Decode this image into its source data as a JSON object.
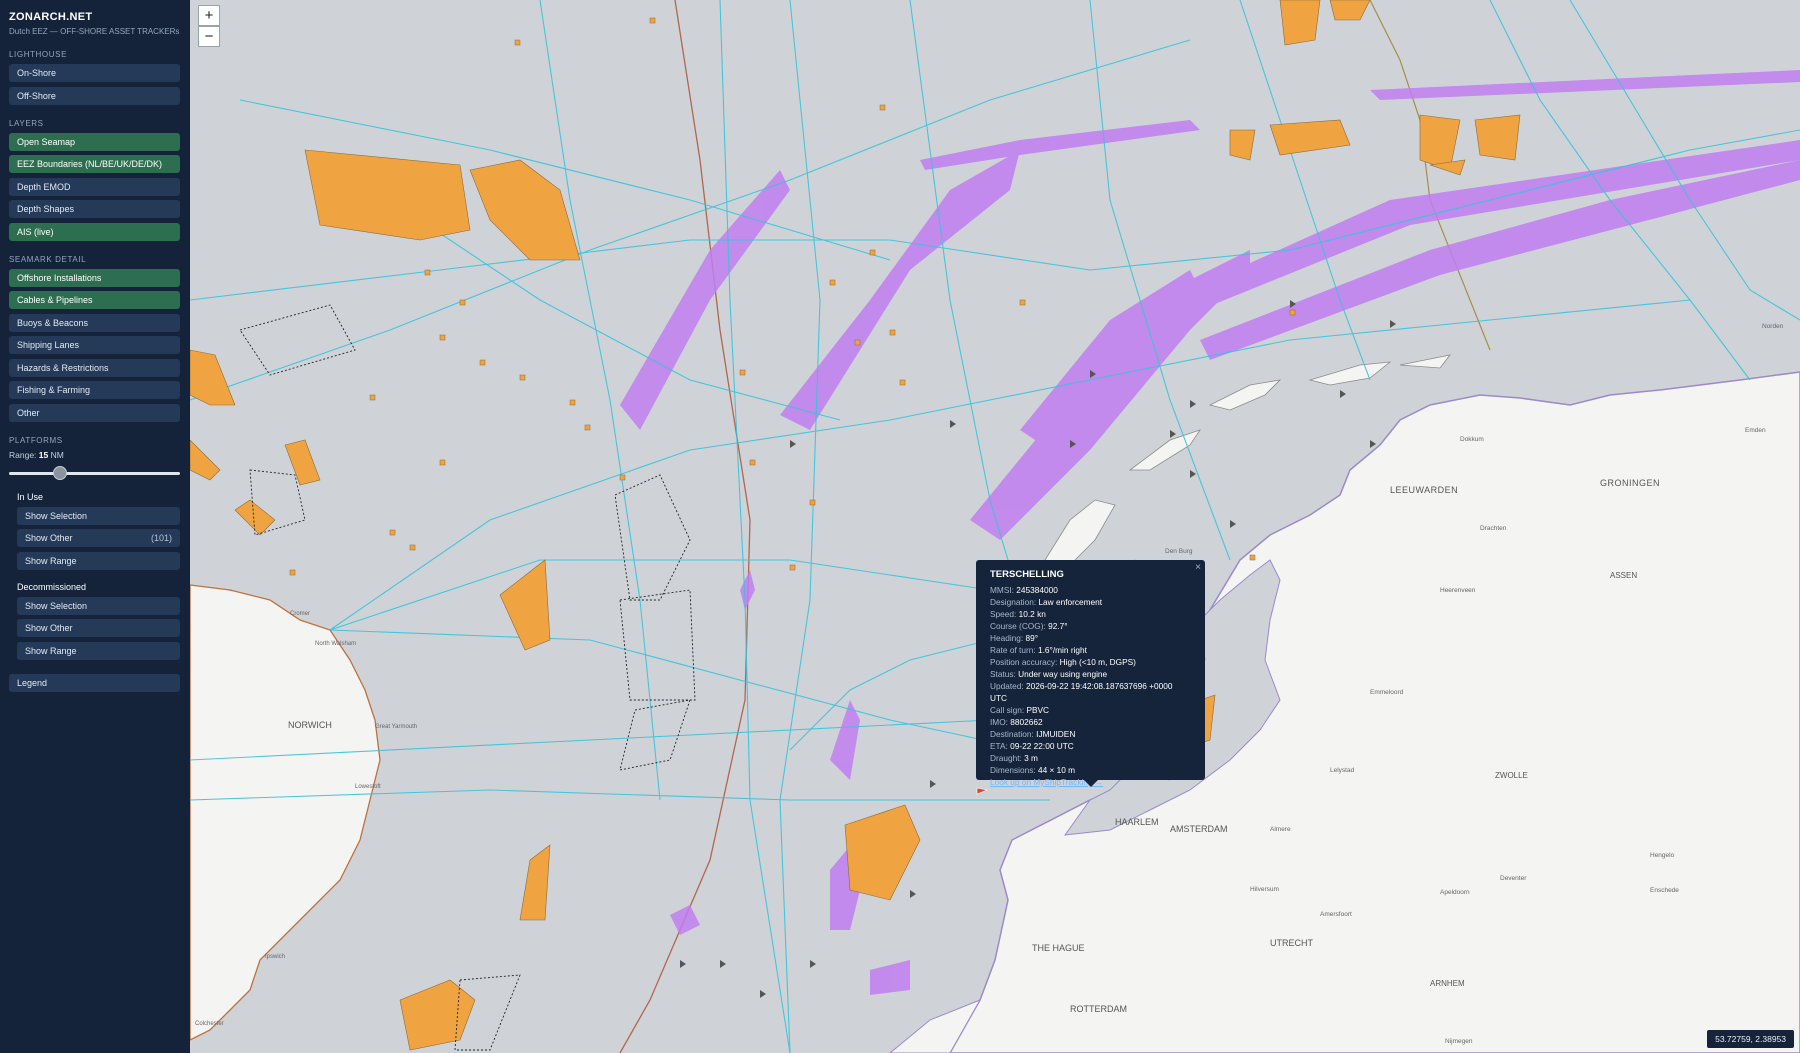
{
  "brand": {
    "title": "ZONARCH.NET",
    "subtitle": "Dutch EEZ — OFF-SHORE ASSET TRACKERs"
  },
  "lighthouse": {
    "heading": "LIGHTHOUSE",
    "items": [
      {
        "label": "On-Shore",
        "active": false
      },
      {
        "label": "Off-Shore",
        "active": false
      }
    ]
  },
  "layers": {
    "heading": "LAYERS",
    "items": [
      {
        "label": "Open Seamap",
        "active": true
      },
      {
        "label": "EEZ Boundaries (NL/BE/UK/DE/DK)",
        "active": true
      },
      {
        "label": "Depth EMOD",
        "active": false
      },
      {
        "label": "Depth Shapes",
        "active": false
      },
      {
        "label": "AIS (live)",
        "active": true
      }
    ]
  },
  "seamark": {
    "heading": "SEAMARK DETAIL",
    "items": [
      {
        "label": "Offshore Installations",
        "active": true
      },
      {
        "label": "Cables & Pipelines",
        "active": true
      },
      {
        "label": "Buoys & Beacons",
        "active": false
      },
      {
        "label": "Shipping Lanes",
        "active": false
      },
      {
        "label": "Hazards & Restrictions",
        "active": false
      },
      {
        "label": "Fishing & Farming",
        "active": false
      },
      {
        "label": "Other",
        "active": false
      }
    ]
  },
  "platforms": {
    "heading": "PLATFORMS",
    "range_label": "Range:",
    "range_value": "15",
    "range_unit": "NM",
    "range_fraction": 0.3,
    "in_use": {
      "heading": "In Use",
      "items": [
        {
          "label": "Show Selection"
        },
        {
          "label": "Show Other",
          "count": "(101)"
        },
        {
          "label": "Show Range"
        }
      ]
    },
    "decommissioned": {
      "heading": "Decommissioned",
      "items": [
        {
          "label": "Show Selection"
        },
        {
          "label": "Show Other"
        },
        {
          "label": "Show Range"
        }
      ]
    }
  },
  "legend_label": "Legend",
  "zoom": {
    "in": "+",
    "out": "−"
  },
  "popup": {
    "title": "TERSCHELLING",
    "close": "×",
    "rows": [
      {
        "k": "MMSI:",
        "v": "245384000"
      },
      {
        "k": "Designation:",
        "v": "Law enforcement"
      },
      {
        "k": "Speed:",
        "v": "10.2 kn"
      },
      {
        "k": "Course (COG):",
        "v": "92.7°"
      },
      {
        "k": "Heading:",
        "v": "89°"
      },
      {
        "k": "Rate of turn:",
        "v": "1.6°/min right"
      },
      {
        "k": "Position accuracy:",
        "v": "High (<10 m, DGPS)"
      },
      {
        "k": "Status:",
        "v": "Under way using engine"
      },
      {
        "k": "Updated:",
        "v": "2026-09-22 19:42:08.187637696 +0000 UTC"
      },
      {
        "k": "Call sign:",
        "v": "PBVC"
      },
      {
        "k": "IMO:",
        "v": "8802662"
      },
      {
        "k": "Destination:",
        "v": "IJMUIDEN"
      },
      {
        "k": "ETA:",
        "v": "09-22 22:00 UTC"
      },
      {
        "k": "Draught:",
        "v": "3 m"
      },
      {
        "k": "Dimensions:",
        "v": "44 × 10 m"
      }
    ],
    "link": "Look up on MyShipTracking →"
  },
  "coords": "53.72759, 2.38953",
  "map_labels": {
    "leeuwarden": "LEEUWARDEN",
    "groningen": "GRONINGEN",
    "assen": "ASSEN",
    "zwolle": "ZWOLLE",
    "haarlem": "HAARLEM",
    "amsterdam": "AMSTERDAM",
    "utrecht": "UTRECHT",
    "the_hague": "THE HAGUE",
    "rotterdam": "ROTTERDAM",
    "arnhem": "ARNHEM",
    "norwich": "NORWICH",
    "den_burg": "Den Burg",
    "dokkum": "Dokkum",
    "drachten": "Drachten",
    "emmeloord": "Emmeloord",
    "heerenveen": "Heerenveen",
    "lelystad": "Lelystad",
    "almere": "Almere",
    "hilversum": "Hilversum",
    "amersfoort": "Amersfoort",
    "apeldoorn": "Apeldoorn",
    "deventer": "Deventer",
    "hengelo": "Hengelo",
    "enschede": "Enschede",
    "nijmegen": "Nijmegen",
    "great_yarmouth": "Great Yarmouth",
    "lowestoft": "Lowestoft",
    "ipswich": "Ipswich",
    "colchester": "Colchester",
    "cromer": "Cromer",
    "north_walsham": "North Walsham",
    "emden": "Emden",
    "norden": "Norden"
  },
  "colors": {
    "sidebar": "#14233a",
    "button": "#243a58",
    "button_active": "#2c6e4f",
    "sea": "#cfd3d8",
    "land": "#f4f4f2",
    "cable": "#39c3da",
    "lane": "#c07ef0",
    "windfarm": "#f0a341",
    "eez": "#7a59c2"
  }
}
